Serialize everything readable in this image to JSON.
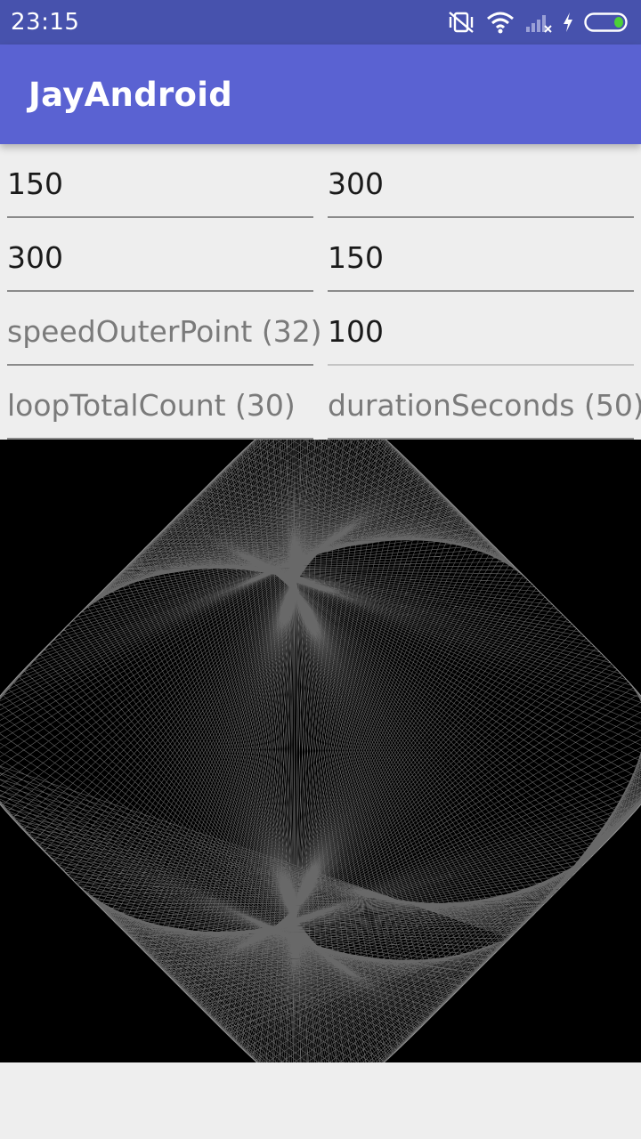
{
  "status_bar": {
    "time": "23:15",
    "icons": [
      "vibrate-off-icon",
      "wifi-icon",
      "signal-icon",
      "charging-icon",
      "battery-icon"
    ]
  },
  "app_bar": {
    "title": "JayAndroid"
  },
  "fields": {
    "r1_left": {
      "value": "150",
      "placeholder": ""
    },
    "r1_right": {
      "value": "300",
      "placeholder": ""
    },
    "r2_left": {
      "value": "300",
      "placeholder": ""
    },
    "r2_right": {
      "value": "150",
      "placeholder": ""
    },
    "r3_left": {
      "value": "",
      "placeholder": "speedOuterPoint (32)"
    },
    "r3_right": {
      "value": "100",
      "placeholder": ""
    },
    "r4_left": {
      "value": "",
      "placeholder": "loopTotalCount (30)"
    },
    "r4_right": {
      "value": "",
      "placeholder": "durationSeconds (50)"
    }
  },
  "colors": {
    "status_bar": "#4752ad",
    "app_bar": "#5a62d2",
    "canvas_bg": "#000000",
    "curve": "#bdbdbd",
    "battery_fill": "#4cd137"
  }
}
